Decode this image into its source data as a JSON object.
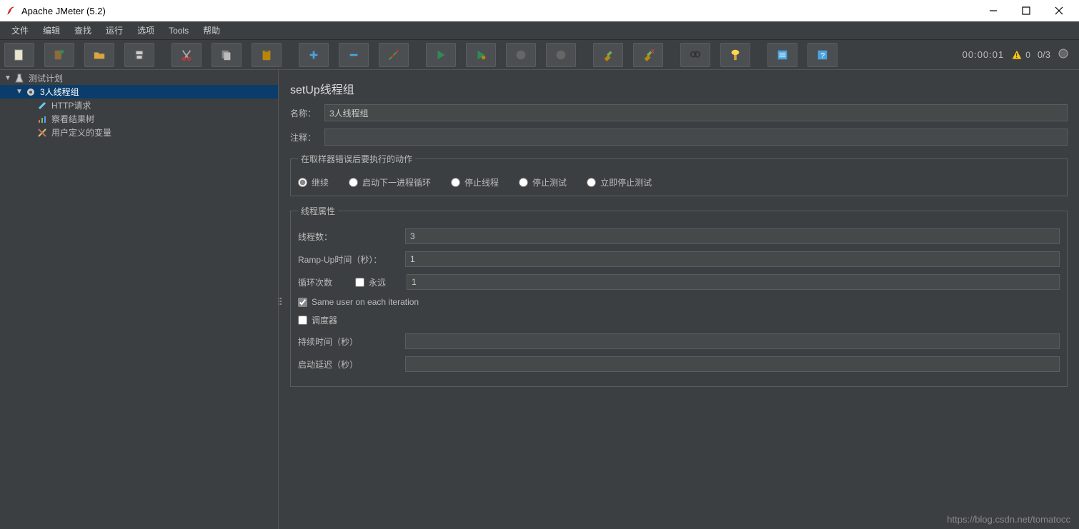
{
  "titlebar": {
    "title": "Apache JMeter (5.2)"
  },
  "menu": {
    "items": [
      "文件",
      "编辑",
      "查找",
      "运行",
      "选项",
      "Tools",
      "帮助"
    ]
  },
  "toolbar_right": {
    "timer": "00:00:01",
    "warn_count": "0",
    "thread_fraction": "0/3"
  },
  "tree": {
    "root": "测试计划",
    "thread_group": "3人线程组",
    "children": [
      "HTTP请求",
      "察看结果树",
      "用户定义的变量"
    ]
  },
  "panel": {
    "title": "setUp线程组",
    "name_label": "名称：",
    "name_value": "3人线程组",
    "comment_label": "注释：",
    "comment_value": ""
  },
  "error_action": {
    "legend": "在取样器错误后要执行的动作",
    "options": [
      "继续",
      "启动下一进程循环",
      "停止线程",
      "停止测试",
      "立即停止测试"
    ],
    "selected": 0
  },
  "thread_props": {
    "legend": "线程属性",
    "threads_label": "线程数：",
    "threads_value": "3",
    "rampup_label": "Ramp-Up时间（秒）：",
    "rampup_value": "1",
    "loop_label": "循环次数",
    "forever_label": "永远",
    "loop_value": "1",
    "same_user_label": "Same user on each iteration",
    "scheduler_label": "调度器",
    "duration_label": "持续时间（秒）",
    "duration_value": "",
    "delay_label": "启动延迟（秒）",
    "delay_value": ""
  },
  "watermark": "https://blog.csdn.net/tomatocc"
}
